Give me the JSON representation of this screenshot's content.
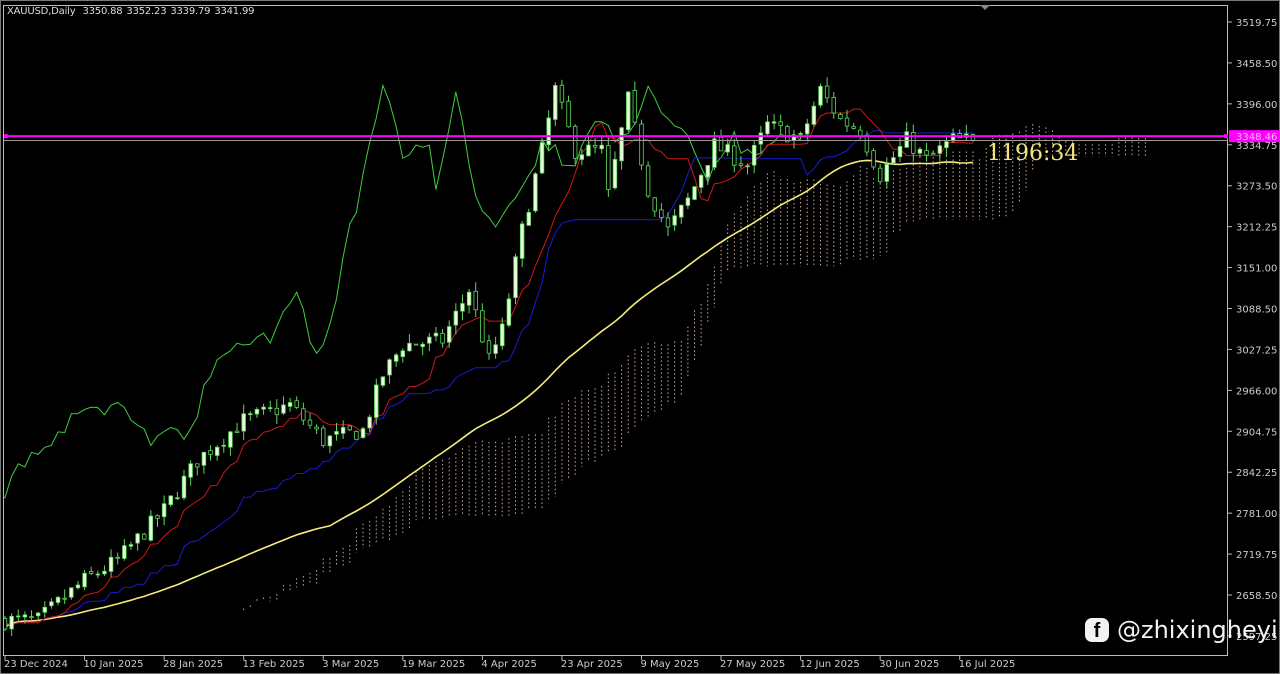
{
  "header": {
    "symbol_timeframe": "XAUUSD,Daily",
    "open": "3350.88",
    "high": "3352.23",
    "low": "3339.79",
    "close": "3341.99"
  },
  "overlay_text": "1196:34",
  "watermark": "@zhixingheyi",
  "colors": {
    "background": "#000000",
    "bull_candle": "#e6ffd8",
    "candle_outline": "#5ed85e",
    "tenkan": "#d01818",
    "kijun": "#1a1ad8",
    "chikou": "#3fcf3f",
    "moving_average": "#f5ec7a",
    "cloud": "#e8c8b8",
    "hline": "#ff00ff",
    "price_line": "#9a9a9a"
  },
  "chart_data": {
    "type": "candlestick",
    "title": "XAUUSD,Daily",
    "symbol": "XAUUSD",
    "timeframe": "Daily",
    "last_bar": {
      "open": 3350.88,
      "high": 3352.23,
      "low": 3339.79,
      "close": 3341.99
    },
    "close_keypoints": [
      [
        0,
        2622
      ],
      [
        5,
        2622
      ],
      [
        12,
        2682
      ],
      [
        17,
        2712
      ],
      [
        24,
        2787
      ],
      [
        29,
        2862
      ],
      [
        36,
        2922
      ],
      [
        43,
        2945
      ],
      [
        48,
        2892
      ],
      [
        54,
        2907
      ],
      [
        57,
        2990
      ],
      [
        60,
        3035
      ],
      [
        66,
        3042
      ],
      [
        70,
        3118
      ],
      [
        73,
        3012
      ],
      [
        75,
        3057
      ],
      [
        78,
        3207
      ],
      [
        81,
        3327
      ],
      [
        83,
        3418
      ],
      [
        86,
        3327
      ],
      [
        90,
        3327
      ],
      [
        91,
        3260
      ],
      [
        94,
        3403
      ],
      [
        97,
        3268
      ],
      [
        100,
        3207
      ],
      [
        103,
        3252
      ],
      [
        107,
        3335
      ],
      [
        112,
        3305
      ],
      [
        115,
        3365
      ],
      [
        120,
        3343
      ],
      [
        123,
        3418
      ],
      [
        126,
        3373
      ],
      [
        129,
        3358
      ],
      [
        132,
        3290
      ],
      [
        136,
        3343
      ],
      [
        139,
        3313
      ],
      [
        143,
        3343
      ],
      [
        146,
        3342
      ]
    ],
    "indicators": [
      "Ichimoku (9,26,52)",
      "Moving Average (50)"
    ],
    "horizontal_line": {
      "value": 3348.46,
      "label": "3348.46"
    },
    "current_price_label": "3341.99",
    "ylim": [
      2597.25,
      3540
    ],
    "y_ticks": [
      "3519.75",
      "3458.50",
      "3396.00",
      "3334.75",
      "3273.50",
      "3212.25",
      "3151.00",
      "3088.50",
      "3027.25",
      "2966.00",
      "2904.75",
      "2842.25",
      "2781.00",
      "2719.75",
      "2658.50",
      "2597.25"
    ],
    "x_ticks": [
      {
        "bar": 0,
        "label": "23 Dec 2024"
      },
      {
        "bar": 12,
        "label": "10 Jan 2025"
      },
      {
        "bar": 24,
        "label": "28 Jan 2025"
      },
      {
        "bar": 36,
        "label": "13 Feb 2025"
      },
      {
        "bar": 48,
        "label": "3 Mar 2025"
      },
      {
        "bar": 60,
        "label": "19 Mar 2025"
      },
      {
        "bar": 72,
        "label": "4 Apr 2025"
      },
      {
        "bar": 84,
        "label": "23 Apr 2025"
      },
      {
        "bar": 96,
        "label": "9 May 2025"
      },
      {
        "bar": 108,
        "label": "27 May 2025"
      },
      {
        "bar": 120,
        "label": "12 Jun 2025"
      },
      {
        "bar": 132,
        "label": "30 Jun 2025"
      },
      {
        "bar": 144,
        "label": "16 Jul 2025"
      }
    ],
    "grid": false
  }
}
